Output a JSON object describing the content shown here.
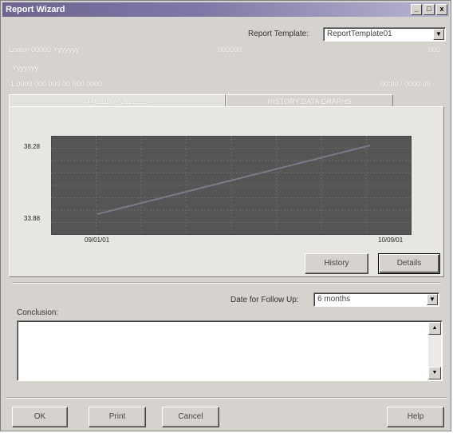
{
  "window": {
    "title": "Report Wizard",
    "controls": {
      "minimize": "_",
      "maximize": "□",
      "close": "x"
    }
  },
  "header": {
    "template_label": "Report Template:",
    "template_value": "ReportTemplate01",
    "info_line1_left": "Lorem 00000 Yyyyyyy",
    "info_line1_mid": "000000",
    "info_line1_right": "000",
    "info_line2": "Yyyyyyy",
    "info_line3_left": "1 0000 000 000 00 000 0000",
    "info_line3_right": "00:00 / 0000 00"
  },
  "tabs": [
    {
      "label": "TREND ANALYSIS",
      "active": true
    },
    {
      "label": "HISTORY DATA GRAPHS",
      "active": false
    }
  ],
  "chart_data": {
    "type": "line",
    "x": [
      "09/01/01",
      "10/09/01"
    ],
    "series": [
      {
        "values": [
          33.88,
          38.28
        ]
      }
    ],
    "y_tick_labels": [
      "38.28",
      "33.88"
    ],
    "x_tick_labels": [
      "09/01/01",
      "10/09/01"
    ],
    "ylim": [
      33.88,
      38.28
    ],
    "grid": true,
    "background_color": "#555555",
    "line_color": "#7a7a8a"
  },
  "chart_buttons": {
    "history": "History",
    "details": "Details"
  },
  "follow_up": {
    "label": "Date for Follow Up:",
    "value": "6 months"
  },
  "conclusion": {
    "label": "Conclusion:",
    "text": ""
  },
  "footer": {
    "ok": "OK",
    "print": "Print",
    "cancel": "Cancel",
    "help": "Help"
  }
}
